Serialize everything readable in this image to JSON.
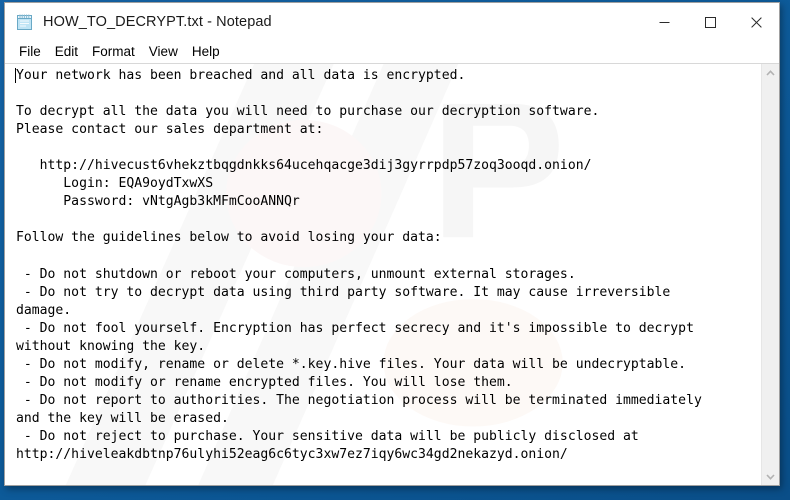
{
  "window": {
    "title": "HOW_TO_DECRYPT.txt - Notepad",
    "icon": "notepad-icon",
    "controls": {
      "minimize": "minimize-icon",
      "maximize": "maximize-icon",
      "close": "close-icon"
    }
  },
  "menubar": {
    "items": [
      {
        "label": "File"
      },
      {
        "label": "Edit"
      },
      {
        "label": "Format"
      },
      {
        "label": "View"
      },
      {
        "label": "Help"
      }
    ]
  },
  "scrollbar": {
    "up_arrow": "chevron-up-icon",
    "down_arrow": "chevron-down-icon"
  },
  "document": {
    "lines": [
      "Your network has been breached and all data is encrypted.",
      "",
      "To decrypt all the data you will need to purchase our decryption software.",
      "Please contact our sales department at:",
      "",
      "   http://hivecust6vhekztbqgdnkks64ucehqacge3dij3gyrrpdp57zoq3ooqd.onion/",
      "      Login: EQA9oydTxwXS",
      "      Password: vNtgAgb3kMFmCooANNQr",
      "",
      "Follow the guidelines below to avoid losing your data:",
      "",
      " - Do not shutdown or reboot your computers, unmount external storages.",
      " - Do not try to decrypt data using third party software. It may cause irreversible",
      "damage.",
      " - Do not fool yourself. Encryption has perfect secrecy and it's impossible to decrypt",
      "without knowing the key.",
      " - Do not modify, rename or delete *.key.hive files. Your data will be undecryptable.",
      " - Do not modify or rename encrypted files. You will lose them.",
      " - Do not report to authorities. The negotiation process will be terminated immediately",
      "and the key will be erased.",
      " - Do not reject to purchase. Your sensitive data will be publicly disclosed at",
      "http://hiveleakdbtnp76ulyhi52eag6c6tyc3xw7ez7iqy6wc34gd2nekazyd.onion/"
    ],
    "text": "Your network has been breached and all data is encrypted.\n\nTo decrypt all the data you will need to purchase our decryption software.\nPlease contact our sales department at:\n\n   http://hivecust6vhekztbqgdnkks64ucehqacge3dij3gyrrpdp57zoq3ooqd.onion/\n      Login: EQA9oydTxwXS\n      Password: vNtgAgb3kMFmCooANNQr\n\nFollow the guidelines below to avoid losing your data:\n\n - Do not shutdown or reboot your computers, unmount external storages.\n - Do not try to decrypt data using third party software. It may cause irreversible\ndamage.\n - Do not fool yourself. Encryption has perfect secrecy and it's impossible to decrypt\nwithout knowing the key.\n - Do not modify, rename or delete *.key.hive files. Your data will be undecryptable.\n - Do not modify or rename encrypted files. You will lose them.\n - Do not report to authorities. The negotiation process will be terminated immediately\nand the key will be erased.\n - Do not reject to purchase. Your sensitive data will be publicly disclosed at\nhttp://hiveleakdbtnp76ulyhi52eag6c6tyc3xw7ez7iqy6wc34gd2nekazyd.onion/"
  },
  "colors": {
    "desktop_blue": "#0f5e9e",
    "window_background": "#ffffff",
    "text": "#000000",
    "scrollbar_track": "#f0f0f0"
  }
}
